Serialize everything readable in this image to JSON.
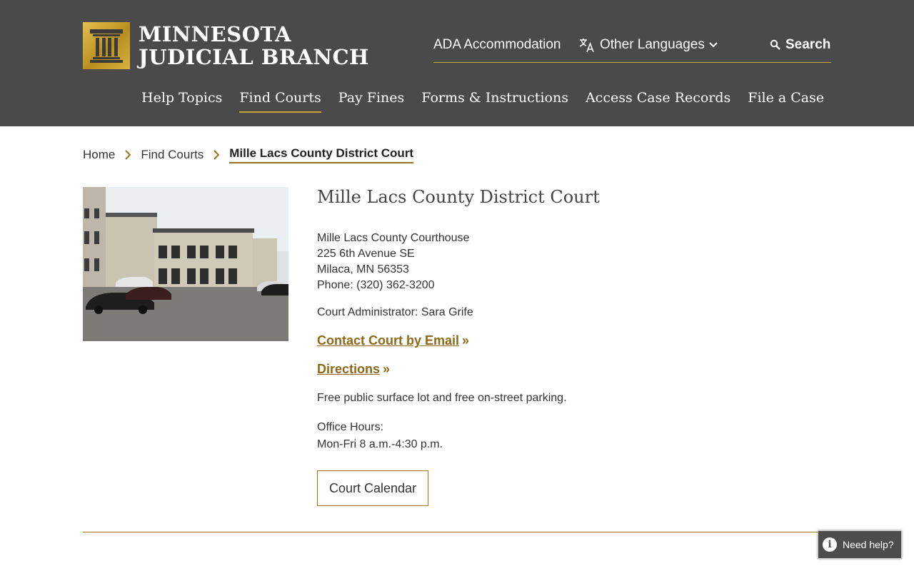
{
  "header": {
    "logo_line1": "MINNESOTA",
    "logo_line2": "JUDICIAL BRANCH",
    "utility": {
      "ada": "ADA Accommodation",
      "languages": "Other Languages",
      "search": "Search"
    },
    "nav": [
      {
        "label": "Help Topics"
      },
      {
        "label": "Find Courts",
        "active": true
      },
      {
        "label": "Pay Fines"
      },
      {
        "label": "Forms & Instructions"
      },
      {
        "label": "Access Case Records"
      },
      {
        "label": "File a Case"
      }
    ]
  },
  "breadcrumb": [
    "Home",
    "Find Courts",
    "Mille Lacs County District Court"
  ],
  "court": {
    "title": "Mille Lacs County District Court",
    "address": [
      "Mille Lacs County Courthouse",
      "225 6th Avenue SE",
      "Milaca, MN 56353",
      "Phone: (320) 362-3200"
    ],
    "administrator": "Court Administrator: Sara Grife",
    "contact_link": "Contact Court by Email",
    "directions_link": "Directions",
    "link_suffix": "»",
    "parking": "Free public surface lot and free on-street parking.",
    "hours_label": "Office Hours:",
    "hours": "Mon-Fri 8 a.m.-4:30 p.m.",
    "calendar_button": "Court Calendar"
  },
  "help_widget": "Need help?",
  "colors": {
    "header_bg": "#4a4a4a",
    "accent_gold": "#9a7320",
    "link_gold": "#8c6a1a"
  }
}
